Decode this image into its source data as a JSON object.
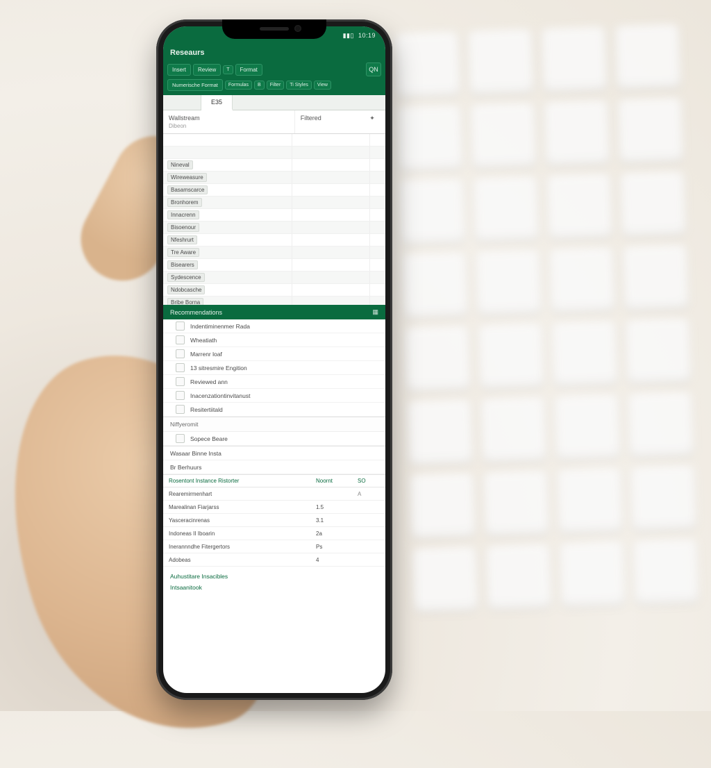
{
  "status": {
    "battery": "▮▮▯",
    "time": "10:19"
  },
  "app": {
    "title": "Reseaurs"
  },
  "toolbar1": {
    "items": [
      "Insert",
      "Review",
      "T",
      "Format"
    ],
    "icon_right": "QN"
  },
  "toolbar2": {
    "lead": "Numerische Format",
    "items": [
      "Formulas",
      "B",
      "Filter",
      "Ti Styles",
      "View"
    ]
  },
  "subtabs": {
    "left": "",
    "right": "E35"
  },
  "columns": {
    "c1": "Wallstream",
    "c2": "Filtered",
    "sub": "Dibeon"
  },
  "grid_rows": [
    "Nineval",
    "Wireweasure",
    "Basamscarce",
    "Bronhorem",
    "Innacrenn",
    "Bisoenour",
    "Nfeshrurt",
    "Tre Aware",
    "Bisearers",
    "Sydescence",
    "Ndobcasche",
    "Bribe Borna"
  ],
  "section_bar": "Recommendations",
  "list1": [
    "Indentiminenmer Rada",
    "Wheatiath",
    "Marrenr loaf",
    "13 sitresmire Engition",
    "Reviewed ann",
    "Inacenzationtinvitanust",
    "Resitertiitald"
  ],
  "subheader1": "Niffyeromit",
  "list2": [
    "Sopece Beare"
  ],
  "list3": [
    "Wasaar Binne Insta",
    "Br Berhuurs"
  ],
  "summary": {
    "header": {
      "label": "Rosentont Instance Ristorter",
      "col2": "Noornt",
      "col3": "SO"
    },
    "rows": [
      {
        "label": "Rearemirmenhart",
        "v2": "",
        "v3": "A"
      },
      {
        "label": "Marealinan Fiarjarss",
        "v2": "1.5",
        "v3": ""
      },
      {
        "label": "Yasceracinrenas",
        "v2": "3.1",
        "v3": ""
      },
      {
        "label": "Indoneas II Iboarin",
        "v2": "2a",
        "v3": ""
      },
      {
        "label": "Inerannndhe Fitergertors",
        "v2": "Ps",
        "v3": ""
      },
      {
        "label": "Adobeas",
        "v2": "4",
        "v3": ""
      }
    ]
  },
  "footer_links": [
    "Auhustitare Insacibles",
    "Intsaanitook"
  ]
}
